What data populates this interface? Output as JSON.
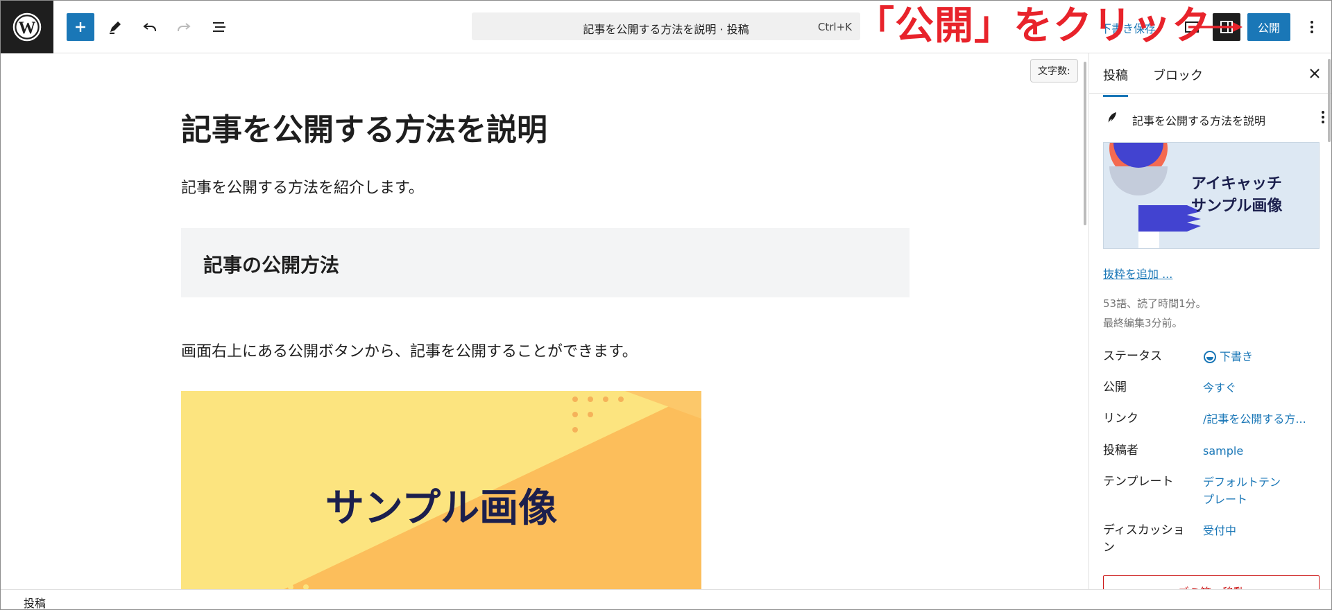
{
  "topbar": {
    "command_title": "記事を公開する方法を説明 · 投稿",
    "command_shortcut": "Ctrl+K",
    "save_draft": "下書き保存",
    "publish": "公開",
    "icons": [
      "wordpress-logo-icon",
      "plus-icon",
      "pencil-icon",
      "undo-icon",
      "redo-icon",
      "list-view-icon",
      "preview-icon",
      "settings-sidebar-icon",
      "more-vertical-icon"
    ]
  },
  "annotation": {
    "text": "「公開」をクリック",
    "color": "#e8232b"
  },
  "editor": {
    "word_count_chip": "文字数:",
    "title": "記事を公開する方法を説明",
    "paragraph1": "記事を公開する方法を紹介します。",
    "heading": "記事の公開方法",
    "paragraph2": "画面右上にある公開ボタンから、記事を公開することができます。",
    "image_text": "サンプル画像"
  },
  "sidebar": {
    "tabs": [
      {
        "label": "投稿",
        "active": true
      },
      {
        "label": "ブロック",
        "active": false
      }
    ],
    "post_title": "記事を公開する方法を説明",
    "featured_image": {
      "line1": "アイキャッチ",
      "line2": "サンプル画像"
    },
    "add_excerpt": "抜粋を追加 ...",
    "meta_line1": "53語、読了時間1分。",
    "meta_line2": "最終編集3分前。",
    "rows": [
      {
        "label": "ステータス",
        "value": "下書き"
      },
      {
        "label": "公開",
        "value": "今すぐ"
      },
      {
        "label": "リンク",
        "value": "/記事を公開する方..."
      },
      {
        "label": "投稿者",
        "value": "sample"
      },
      {
        "label": "テンプレート",
        "value": "デフォルトテンプレート"
      },
      {
        "label": "ディスカッション",
        "value": "受付中"
      }
    ],
    "trash": "ゴミ箱へ移動"
  },
  "footer": {
    "breadcrumb": "投稿"
  },
  "colors": {
    "accent": "#1a77b7",
    "dark": "#1e1e1e",
    "annotation_red": "#e8232b"
  }
}
